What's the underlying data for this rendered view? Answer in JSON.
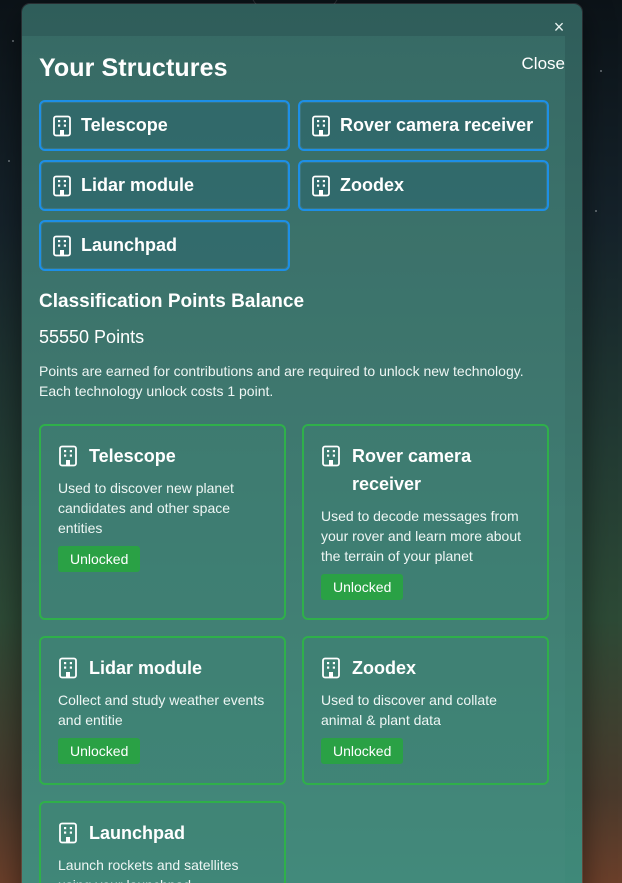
{
  "modal": {
    "close_x_label": "×",
    "title": "Your Structures",
    "close_label": "Close"
  },
  "structures": [
    {
      "label": "Telescope",
      "icon": "building-icon"
    },
    {
      "label": "Rover camera receiver",
      "icon": "building-icon"
    },
    {
      "label": "Lidar module",
      "icon": "building-icon"
    },
    {
      "label": "Zoodex",
      "icon": "building-icon"
    },
    {
      "label": "Launchpad",
      "icon": "building-icon"
    }
  ],
  "balance": {
    "title": "Classification Points Balance",
    "points": "55550 Points",
    "description": "Points are earned for contributions and are required to unlock new technology. Each technology unlock costs 1 point."
  },
  "technologies": [
    {
      "name": "Telescope",
      "description": "Used to discover new planet candidates and other space entities",
      "status": "Unlocked"
    },
    {
      "name": "Rover camera receiver",
      "description": "Used to decode messages from your rover and learn more about the terrain of your planet",
      "status": "Unlocked"
    },
    {
      "name": "Lidar module",
      "description": "Collect and study weather events and entitie",
      "status": "Unlocked"
    },
    {
      "name": "Zoodex",
      "description": "Used to discover and collate animal & plant data",
      "status": "Unlocked"
    },
    {
      "name": "Launchpad",
      "description": "Launch rockets and satellites using your launchpad",
      "status": ""
    }
  ],
  "colors": {
    "accent_blue": "#1d8fe6",
    "accent_green": "#2fb04a",
    "badge_green": "#2aa145"
  }
}
